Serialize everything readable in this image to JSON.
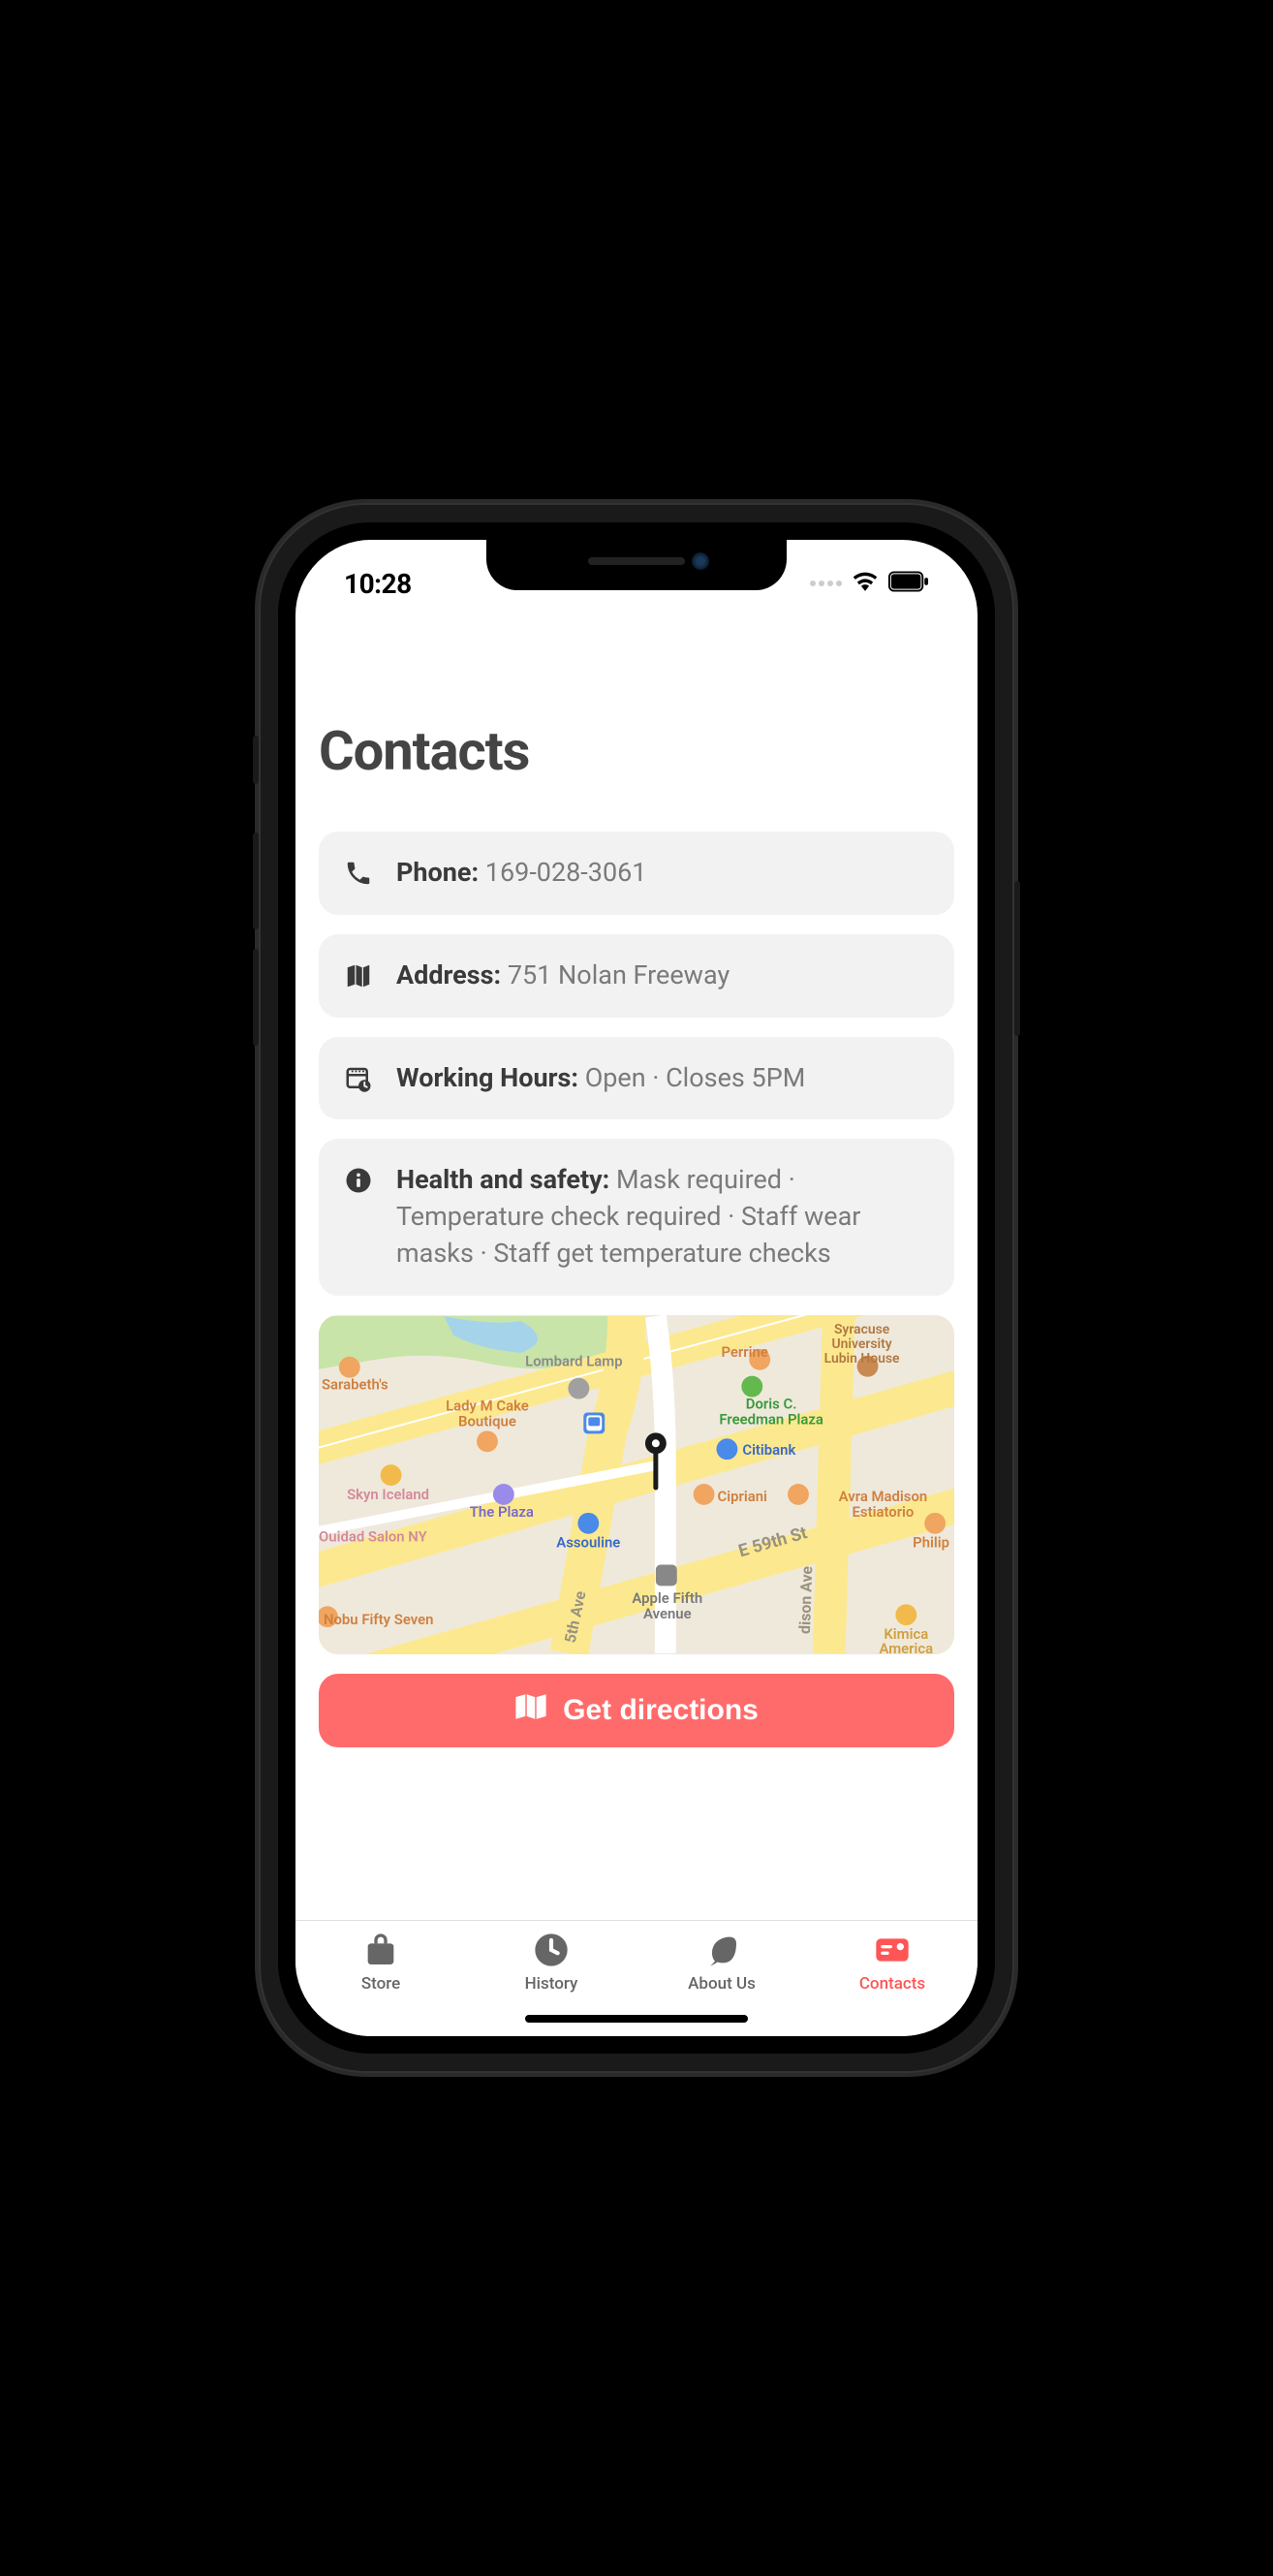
{
  "status_bar": {
    "time": "10:28"
  },
  "page": {
    "title": "Contacts"
  },
  "info": {
    "phone": {
      "label": "Phone:",
      "value": "169-028-3061"
    },
    "address": {
      "label": "Address:",
      "value": "751 Nolan Freeway"
    },
    "hours": {
      "label": "Working Hours:",
      "value": "Open  ·  Closes 5PM"
    },
    "health": {
      "label": "Health and safety:",
      "value": "Mask required · Temperature check required · Staff wear masks · Staff get temperature checks"
    }
  },
  "map": {
    "pois": [
      {
        "name": "Lombard Lamp",
        "type": "landmark"
      },
      {
        "name": "Perrine",
        "type": "restaurant"
      },
      {
        "name": "Syracuse University Lubin House",
        "type": "education"
      },
      {
        "name": "Sarabeth's",
        "type": "restaurant"
      },
      {
        "name": "Lady M Cake Boutique",
        "type": "restaurant"
      },
      {
        "name": "Doris C. Freedman Plaza",
        "type": "park"
      },
      {
        "name": "Citibank",
        "type": "bank"
      },
      {
        "name": "Skyn Iceland",
        "type": "shop"
      },
      {
        "name": "The Plaza",
        "type": "hotel"
      },
      {
        "name": "Cipriani",
        "type": "restaurant"
      },
      {
        "name": "Avra Madison Estiatorio",
        "type": "restaurant"
      },
      {
        "name": "Ouidad Salon NY",
        "type": "salon"
      },
      {
        "name": "Assouline",
        "type": "shop"
      },
      {
        "name": "Philip",
        "type": "restaurant"
      },
      {
        "name": "Apple Fifth Avenue",
        "type": "store"
      },
      {
        "name": "Nobu Fifty Seven",
        "type": "restaurant"
      },
      {
        "name": "Kimica America",
        "type": "shop"
      }
    ],
    "streets": [
      "E 59th St",
      "5th Ave",
      "dison Ave"
    ]
  },
  "directions_button": "Get directions",
  "tabs": {
    "store": "Store",
    "history": "History",
    "about": "About Us",
    "contacts": "Contacts"
  }
}
